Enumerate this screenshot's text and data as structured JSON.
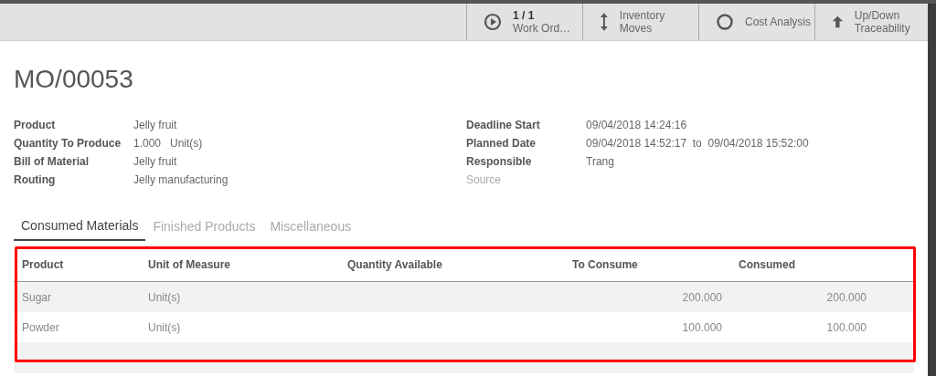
{
  "toolbar": [
    {
      "kind": "play",
      "count": "1 / 1",
      "label": "Work Ord…"
    },
    {
      "kind": "updown",
      "label": "Inventory Moves"
    },
    {
      "kind": "circle",
      "label": "Cost Analysis"
    },
    {
      "kind": "up",
      "label": "Up/Down Traceability"
    }
  ],
  "title": "MO/00053",
  "fields_left": [
    {
      "label": "Product",
      "value": "Jelly fruit"
    },
    {
      "label": "Quantity To Produce",
      "value": "1.000",
      "unit": "Unit(s)"
    },
    {
      "label": "Bill of Material",
      "value": "Jelly fruit"
    },
    {
      "label": "Routing",
      "value": "Jelly manufacturing"
    }
  ],
  "fields_right": [
    {
      "label": "Deadline Start",
      "value": "09/04/2018 14:24:16",
      "disabled": false
    },
    {
      "label": "Planned Date",
      "value": "09/04/2018 14:52:17",
      "to": "to",
      "end": "09/04/2018 15:52:00",
      "disabled": false
    },
    {
      "label": "Responsible",
      "value": "Trang",
      "disabled": false
    },
    {
      "label": "Source",
      "disabled": true
    }
  ],
  "tabs": [
    {
      "label": "Consumed Materials",
      "selected": true
    },
    {
      "label": "Finished Products",
      "selected": false
    },
    {
      "label": "Miscellaneous",
      "selected": false
    }
  ],
  "table": {
    "columns": [
      "Product",
      "Unit of Measure",
      "Quantity Available",
      "To Consume",
      "Consumed"
    ],
    "rows": [
      [
        "Sugar",
        "Unit(s)",
        "",
        "200.000",
        "200.000"
      ],
      [
        "Powder",
        "Unit(s)",
        "",
        "100.000",
        "100.000"
      ]
    ]
  }
}
